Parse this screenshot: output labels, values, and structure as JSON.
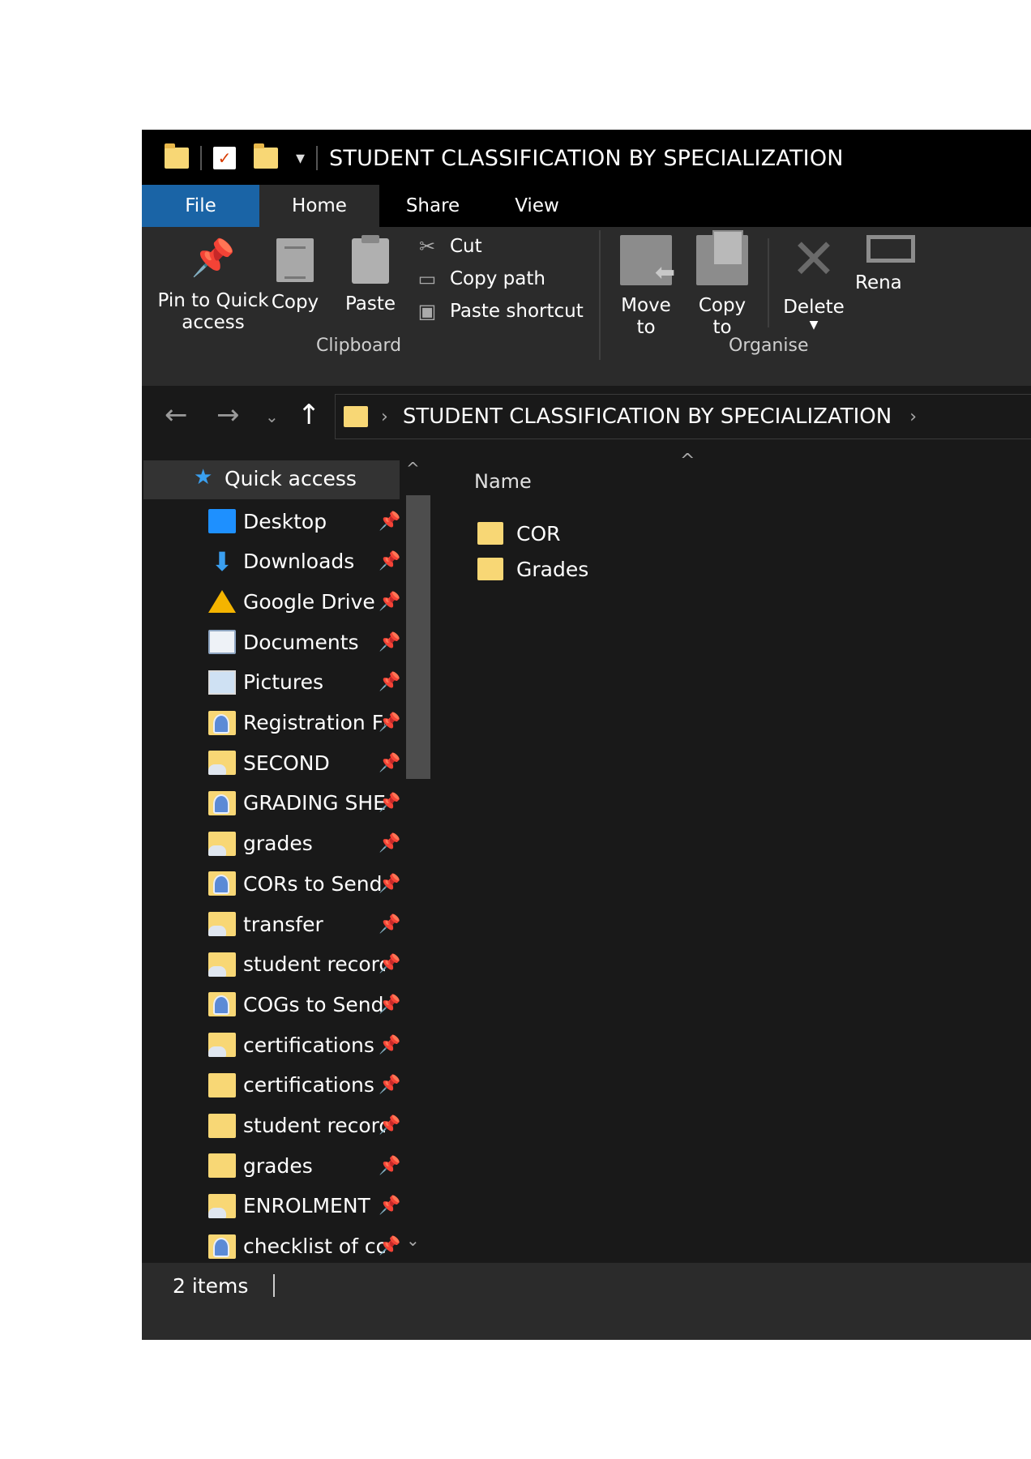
{
  "window": {
    "title": "STUDENT CLASSIFICATION BY SPECIALIZATION"
  },
  "ribbon_tabs": [
    {
      "label": "File"
    },
    {
      "label": "Home"
    },
    {
      "label": "Share"
    },
    {
      "label": "View"
    }
  ],
  "clipboard": {
    "pin_label_1": "Pin to Quick",
    "pin_label_2": "access",
    "copy": "Copy",
    "paste": "Paste",
    "cut": "Cut",
    "copy_path": "Copy path",
    "paste_shortcut": "Paste shortcut",
    "group_label": "Clipboard"
  },
  "organise": {
    "move_1": "Move",
    "move_2": "to",
    "copy_1": "Copy",
    "copy_2": "to",
    "delete": "Delete",
    "rename": "Rena",
    "group_label": "Organise"
  },
  "address": {
    "path": "STUDENT CLASSIFICATION BY SPECIALIZATION"
  },
  "navigation": {
    "quick_access": "Quick access",
    "items": [
      {
        "label": "Desktop",
        "icon": "desktop-icon"
      },
      {
        "label": "Downloads",
        "icon": "downloads-icon"
      },
      {
        "label": "Google Drive",
        "icon": "google-drive-icon"
      },
      {
        "label": "Documents",
        "icon": "documents-icon"
      },
      {
        "label": "Pictures",
        "icon": "pictures-icon"
      },
      {
        "label": "Registration Fc",
        "icon": "shared-folder-icon"
      },
      {
        "label": "SECOND",
        "icon": "cloud-folder-icon"
      },
      {
        "label": "GRADING SHE",
        "icon": "shared-folder-icon"
      },
      {
        "label": "grades",
        "icon": "cloud-folder-icon"
      },
      {
        "label": "CORs to Send",
        "icon": "shared-folder-icon"
      },
      {
        "label": "transfer",
        "icon": "cloud-folder-icon"
      },
      {
        "label": "student recorc",
        "icon": "cloud-folder-icon"
      },
      {
        "label": "COGs to Send",
        "icon": "shared-folder-icon"
      },
      {
        "label": "certifications",
        "icon": "cloud-folder-icon"
      },
      {
        "label": "certifications",
        "icon": "folder-icon"
      },
      {
        "label": "student recorc",
        "icon": "folder-icon"
      },
      {
        "label": "grades",
        "icon": "folder-icon"
      },
      {
        "label": "ENROLMENT",
        "icon": "cloud-folder-icon"
      },
      {
        "label": "checklist of co",
        "icon": "shared-folder-icon"
      }
    ]
  },
  "content": {
    "column_name": "Name",
    "files": [
      {
        "label": "COR"
      },
      {
        "label": "Grades"
      }
    ]
  },
  "status": {
    "text": "2 items"
  },
  "colors": {
    "file_tab": "#1a64a6",
    "ribbon_bg": "#2b2b2b",
    "pane_bg": "#191919",
    "folder": "#f8d775"
  }
}
